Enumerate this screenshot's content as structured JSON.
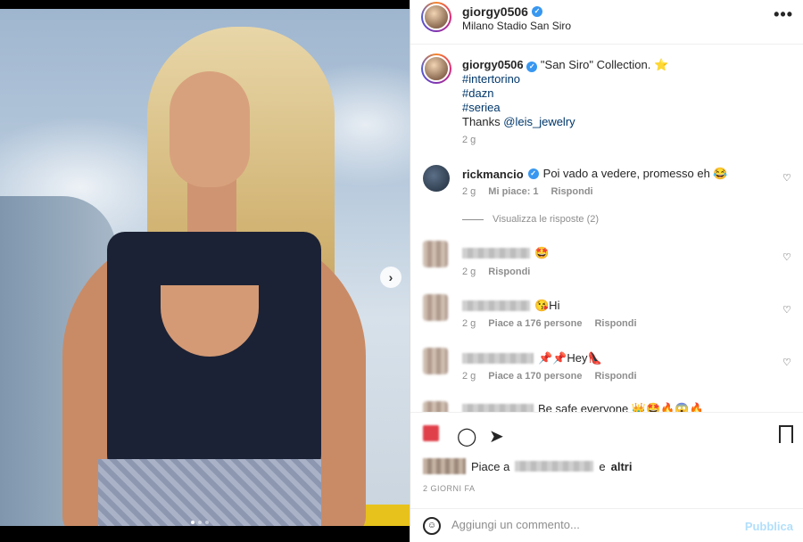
{
  "post": {
    "username": "giorgy0506",
    "location": "Milano Stadio San Siro",
    "caption_text": "\"San Siro\" Collection.",
    "caption_star": "⭐",
    "hashtags": [
      "#intertorino",
      "#dazn",
      "#seriea"
    ],
    "thanks_text": "Thanks",
    "mention": "@leis_jewelry",
    "caption_time": "2 g"
  },
  "comments": [
    {
      "username": "rickmancio",
      "text": "Poi vado a vedere, promesso eh 😂",
      "time": "2 g",
      "likes": "Mi piace: 1",
      "reply": "Rispondi",
      "view_replies": "Visualizza le risposte (2)"
    },
    {
      "text": "🤩",
      "time": "2 g",
      "reply": "Rispondi"
    },
    {
      "text": "😘Hi",
      "time": "2 g",
      "likes": "Piace a 176 persone",
      "reply": "Rispondi"
    },
    {
      "text": "📌📌Hey👠",
      "time": "2 g",
      "likes": "Piace a 170 persone",
      "reply": "Rispondi"
    },
    {
      "text": "Be safe everyone 👑🤩🔥😱🔥"
    }
  ],
  "likes": {
    "prefix": "Piace a",
    "and": "e",
    "others": "altri"
  },
  "post_time": "2 GIORNI FA",
  "comment_input": {
    "placeholder": "Aggiungi un commento..."
  },
  "publish_label": "Pubblica",
  "icons": {
    "more": "•••",
    "verified": "✓",
    "heart": "♡",
    "comment": "◯",
    "share": "➤",
    "bookmark": "🔖",
    "next": "›",
    "emoji": "☺"
  }
}
